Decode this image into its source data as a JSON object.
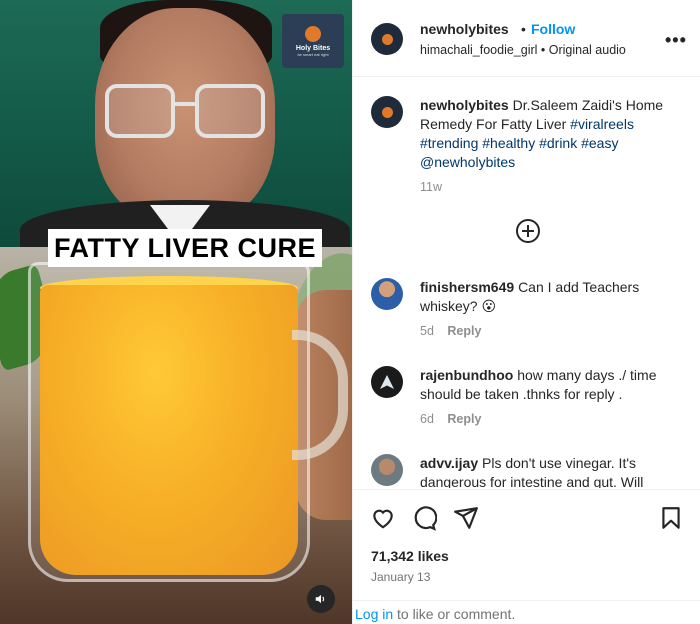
{
  "media": {
    "overlay_caption": "FATTY LIVER CURE",
    "brand_logo_title": "Holy Bites",
    "brand_logo_tagline": "be smart eat right",
    "audio_icon": "speaker-icon"
  },
  "header": {
    "username": "newholybites",
    "separator": "•",
    "follow_label": "Follow",
    "audio_credit": "himachali_foodie_girl • Original audio",
    "more_icon": "more-options-icon"
  },
  "caption": {
    "username": "newholybites",
    "text": "Dr.Saleem Zaidi's Home Remedy For Fatty Liver",
    "hashtags_line1": "#viralreels",
    "hashtags_line2": "#trending #healthy #drink #easy",
    "mention": "@newholybites",
    "age": "11w"
  },
  "load_more_icon": "plus-circle-icon",
  "comments": [
    {
      "username": "finishersm649",
      "text": "Can I add Teachers whiskey? 😮",
      "age": "5d",
      "reply_label": "Reply"
    },
    {
      "username": "rajenbundhoo",
      "text": "how many days ./ time should be taken .thnks for reply .",
      "age": "6d",
      "reply_label": "Reply"
    },
    {
      "username": "advv.ijay",
      "text": "Pls don't use vinegar. It's dangerous for intestine and gut. Will",
      "age": "",
      "reply_label": ""
    }
  ],
  "actions": {
    "like_icon": "heart-icon",
    "comment_icon": "comment-icon",
    "share_icon": "share-icon",
    "save_icon": "bookmark-icon",
    "likes": "71,342 likes",
    "date": "January 13"
  },
  "login": {
    "link": "Log in",
    "rest": "to like or comment."
  },
  "colors": {
    "link_blue": "#0095f6",
    "hashtag_blue": "#00376b",
    "muted": "#8e8e8e"
  }
}
